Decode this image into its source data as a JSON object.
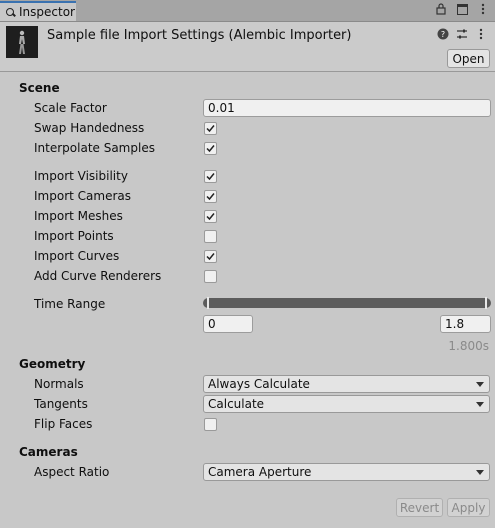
{
  "tab": {
    "label": "Inspector",
    "icon": "search-icon"
  },
  "tab_tools": [
    "lock-icon",
    "window-icon",
    "more-icon"
  ],
  "header": {
    "title": "Sample file Import Settings (Alembic Importer)",
    "open_label": "Open",
    "icons": [
      "help-icon",
      "settings-sliders-icon",
      "more-vertical-icon"
    ]
  },
  "scene": {
    "heading": "Scene",
    "scale_factor_label": "Scale Factor",
    "scale_factor_value": "0.01",
    "swap_handedness_label": "Swap Handedness",
    "swap_handedness": true,
    "interpolate_samples_label": "Interpolate Samples",
    "interpolate_samples": true,
    "import_visibility_label": "Import Visibility",
    "import_visibility": true,
    "import_cameras_label": "Import Cameras",
    "import_cameras": true,
    "import_meshes_label": "Import Meshes",
    "import_meshes": true,
    "import_points_label": "Import Points",
    "import_points": false,
    "import_curves_label": "Import Curves",
    "import_curves": true,
    "add_curve_renderers_label": "Add Curve Renderers",
    "add_curve_renderers": false,
    "time_range_label": "Time Range",
    "time_range_start": "0",
    "time_range_end": "1.8",
    "time_range_start_fraction": 0.0,
    "time_range_end_fraction": 1.0,
    "time_range_duration": "1.800s"
  },
  "geometry": {
    "heading": "Geometry",
    "normals_label": "Normals",
    "normals_value": "Always Calculate",
    "tangents_label": "Tangents",
    "tangents_value": "Calculate",
    "flip_faces_label": "Flip Faces",
    "flip_faces": false
  },
  "cameras": {
    "heading": "Cameras",
    "aspect_ratio_label": "Aspect Ratio",
    "aspect_ratio_value": "Camera Aperture"
  },
  "footer": {
    "revert_label": "Revert",
    "apply_label": "Apply"
  },
  "colors": {
    "accent": "#3a72b0",
    "panel": "#c8c8c8",
    "slider_track": "#5c5c5c"
  }
}
